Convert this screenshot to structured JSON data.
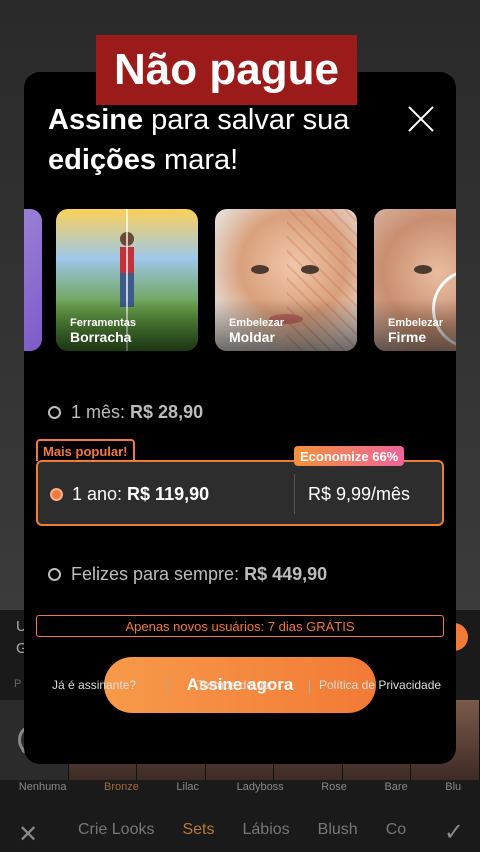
{
  "banner": "Não pague",
  "title": {
    "line1_bold": "Assine",
    "line1_rest": " para salvar sua",
    "line2_bold": "edições",
    "line2_rest": " mara!"
  },
  "cards": [
    {
      "small": "Ferramentas",
      "big": "Borracha"
    },
    {
      "small": "Embelezar",
      "big": "Moldar"
    },
    {
      "small": "Embelezar",
      "big": "Firme"
    }
  ],
  "plans": {
    "month": {
      "label": "1 mês:",
      "price": "R$ 28,90"
    },
    "year": {
      "tag": "Mais popular!",
      "label": "1 ano:",
      "price": "R$ 119,90",
      "per_month": "R$ 9,99/mês",
      "badge": "Economize 66%"
    },
    "forever": {
      "label": "Felizes para sempre:",
      "price": "R$ 449,90"
    }
  },
  "trial_text": "Apenas novos usuários: 7 dias GRÁTIS",
  "cta_label": "Assine agora",
  "links": {
    "subscriber": "Já é assinante?",
    "terms": "Termos de uso",
    "privacy": "Política de Privacidade"
  },
  "background": {
    "side_u": "U",
    "side_g": "G",
    "side_p": "P",
    "presets": [
      "Nenhuma",
      "Bronze",
      "Lilac",
      "Ladyboss",
      "Rose",
      "Bare",
      "Blu"
    ],
    "tabs": [
      "Crie Looks",
      "Sets",
      "Lábios",
      "Blush",
      "Co"
    ]
  },
  "colors": {
    "accent": "#f07a3a",
    "banner": "#9b1b1b"
  }
}
